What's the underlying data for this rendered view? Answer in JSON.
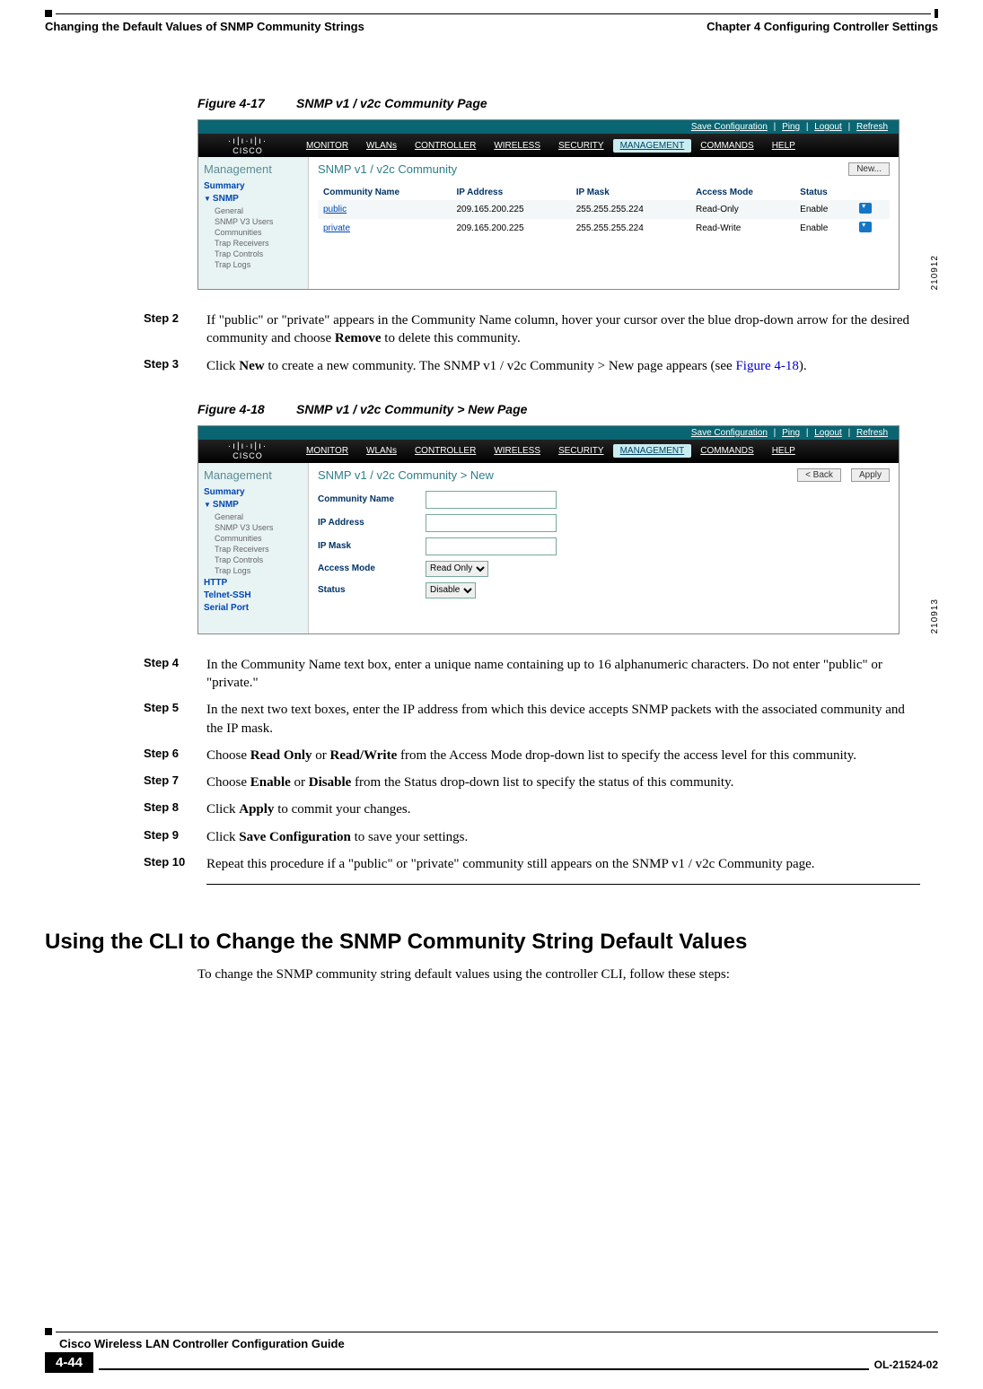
{
  "header": {
    "chapter": "Chapter 4      Configuring Controller Settings",
    "section": "Changing the Default Values of SNMP Community Strings"
  },
  "fig17": {
    "label": "Figure 4-17",
    "title": "SNMP v1 / v2c Community Page",
    "imgid": "210912",
    "topbar": {
      "save": "Save Configuration",
      "ping": "Ping",
      "logout": "Logout",
      "refresh": "Refresh"
    },
    "brand": "CISCO",
    "menu": [
      "MONITOR",
      "WLANs",
      "CONTROLLER",
      "WIRELESS",
      "SECURITY",
      "MANAGEMENT",
      "COMMANDS",
      "HELP"
    ],
    "activeMenu": "MANAGEMENT",
    "side": {
      "title": "Management",
      "summary": "Summary",
      "snmp": "SNMP",
      "items": [
        "General",
        "SNMP V3 Users",
        "Communities",
        "Trap Receivers",
        "Trap Controls",
        "Trap Logs"
      ]
    },
    "page_title": "SNMP v1 / v2c Community",
    "new_btn": "New...",
    "th": [
      "Community Name",
      "IP Address",
      "IP Mask",
      "Access Mode",
      "Status"
    ],
    "rows": [
      {
        "name": "public",
        "ip": "209.165.200.225",
        "mask": "255.255.255.224",
        "mode": "Read-Only",
        "status": "Enable"
      },
      {
        "name": "private",
        "ip": "209.165.200.225",
        "mask": "255.255.255.224",
        "mode": "Read-Write",
        "status": "Enable"
      }
    ]
  },
  "step2": {
    "label": "Step 2",
    "pre": "If \"public\" or \"private\" appears in the Community Name column, hover your cursor over the blue drop-down arrow for the desired community and choose ",
    "b1": "Remove",
    "post": " to delete this community."
  },
  "step3": {
    "label": "Step 3",
    "pre": "Click ",
    "b1": "New",
    "mid": " to create a new community. The SNMP v1 / v2c Community > New page appears (see ",
    "xref": "Figure 4-18",
    "post": ")."
  },
  "fig18": {
    "label": "Figure 4-18",
    "title": "SNMP v1 / v2c Community > New Page",
    "imgid": "210913",
    "page_title": "SNMP v1 / v2c Community > New",
    "back_btn": "< Back",
    "apply_btn": "Apply",
    "side_extra": [
      "HTTP",
      "Telnet-SSH",
      "Serial Port"
    ],
    "fields": {
      "cn": "Community Name",
      "ip": "IP Address",
      "mask": "IP Mask",
      "am": "Access Mode",
      "am_val": "Read Only",
      "st": "Status",
      "st_val": "Disable"
    }
  },
  "step4": {
    "label": "Step 4",
    "text": "In the Community Name text box, enter a unique name containing up to 16 alphanumeric characters. Do not enter \"public\" or \"private.\""
  },
  "step5": {
    "label": "Step 5",
    "text": "In the next two text boxes, enter the IP address from which this device accepts SNMP packets with the associated community and the IP mask."
  },
  "step6": {
    "label": "Step 6",
    "pre": "Choose ",
    "b1": "Read Only",
    "mid": " or ",
    "b2": "Read/Write",
    "post": " from the Access Mode drop-down list to specify the access level for this community."
  },
  "step7": {
    "label": "Step 7",
    "pre": "Choose ",
    "b1": "Enable",
    "mid": " or ",
    "b2": "Disable",
    "post": " from the Status drop-down list to specify the status of this community."
  },
  "step8": {
    "label": "Step 8",
    "pre": "Click ",
    "b1": "Apply",
    "post": " to commit your changes."
  },
  "step9": {
    "label": "Step 9",
    "pre": "Click ",
    "b1": "Save Configuration",
    "post": " to save your settings."
  },
  "step10": {
    "label": "Step 10",
    "text": "Repeat this procedure if a \"public\" or \"private\" community still appears on the SNMP v1 / v2c Community page."
  },
  "h2": "Using the CLI to Change the SNMP Community String Default Values",
  "cli_intro": "To change the SNMP community string default values using the controller CLI, follow these steps:",
  "footer": {
    "title": "Cisco Wireless LAN Controller Configuration Guide",
    "pagenum": "4-44",
    "docid": "OL-21524-02"
  }
}
